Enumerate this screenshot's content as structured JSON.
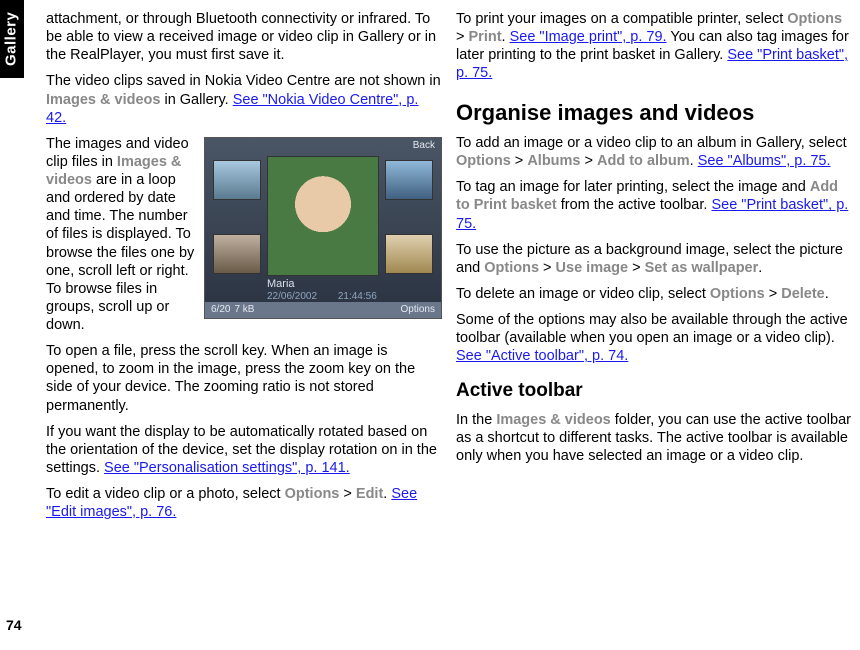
{
  "sideTab": "Gallery",
  "pageNumber": "74",
  "phone": {
    "back": "Back",
    "name": "Maria",
    "date": "22/06/2002",
    "time": "21:44:56",
    "counter": "6/20",
    "size": "7 kB",
    "options": "Options"
  },
  "left": {
    "p1a": "attachment, or through Bluetooth connectivity or infrared. To be able to view a received image or video clip in Gallery or in the RealPlayer, you must first save it.",
    "p2a": "The video clips saved in Nokia Video Centre are not shown in ",
    "p2ui": "Images & videos",
    "p2b": " in Gallery. ",
    "p2link": "See \"Nokia Video Centre\", p. 42.",
    "p3a": "The images and video clip files in ",
    "p3ui": "Images & videos",
    "p3b": " are in a loop and ordered by date and time. The number of files is displayed. To browse the files one by one, scroll left or right. To browse files in groups, scroll up or down.",
    "p4": "To open a file, press the scroll key. When an image is opened, to zoom in the image, press the zoom key on the side of your device. The zooming ratio is not stored permanently.",
    "p5a": "If you want the display to be automatically rotated based on the orientation of the device, set the display rotation on in the settings. ",
    "p5link": "See \"Personalisation settings\", p. 141.",
    "p6a": "To edit a video clip or a photo, select ",
    "p6ui1": "Options",
    "p6gt": " > ",
    "p6ui2": "Edit",
    "p6b": ". ",
    "p6link": "See \"Edit images\", p. 76."
  },
  "right": {
    "p1a": "To print your images on a compatible printer, select ",
    "p1ui1": "Options",
    "p1gt": " > ",
    "p1ui2": "Print",
    "p1b": ". ",
    "p1link": "See \"Image print\", p. 79.",
    "p1c": " You can also tag images for later printing to the print basket in Gallery. ",
    "p1link2": "See \"Print basket\", p. 75.",
    "h2": "Organise images and videos",
    "p2a": "To add an image or a video clip to an album in Gallery, select ",
    "p2ui1": "Options",
    "gt": " > ",
    "p2ui2": "Albums",
    "p2ui3": "Add to album",
    "p2b": ". ",
    "p2link": "See \"Albums\", p. 75.",
    "p3a": "To tag an image for later printing, select the image and ",
    "p3ui": "Add to Print basket",
    "p3b": " from the active toolbar. ",
    "p3link": "See \"Print basket\", p. 75.",
    "p4a": "To use the picture as a background image, select the picture and ",
    "p4ui1": "Options",
    "p4ui2": "Use image",
    "p4ui3": "Set as wallpaper",
    "p4b": ".",
    "p5a": "To delete an image or video clip, select ",
    "p5ui1": "Options",
    "p5ui2": "Delete",
    "p5b": ".",
    "p6a": "Some of the options may also be available through the active toolbar (available when you open an image or a video clip). ",
    "p6link": "See \"Active toolbar\", p. 74.",
    "h3": "Active toolbar",
    "p7a": "In the ",
    "p7ui": "Images & videos",
    "p7b": " folder, you can use the active toolbar as a shortcut to different tasks. The active toolbar is available only when you have selected an image or a video clip."
  }
}
